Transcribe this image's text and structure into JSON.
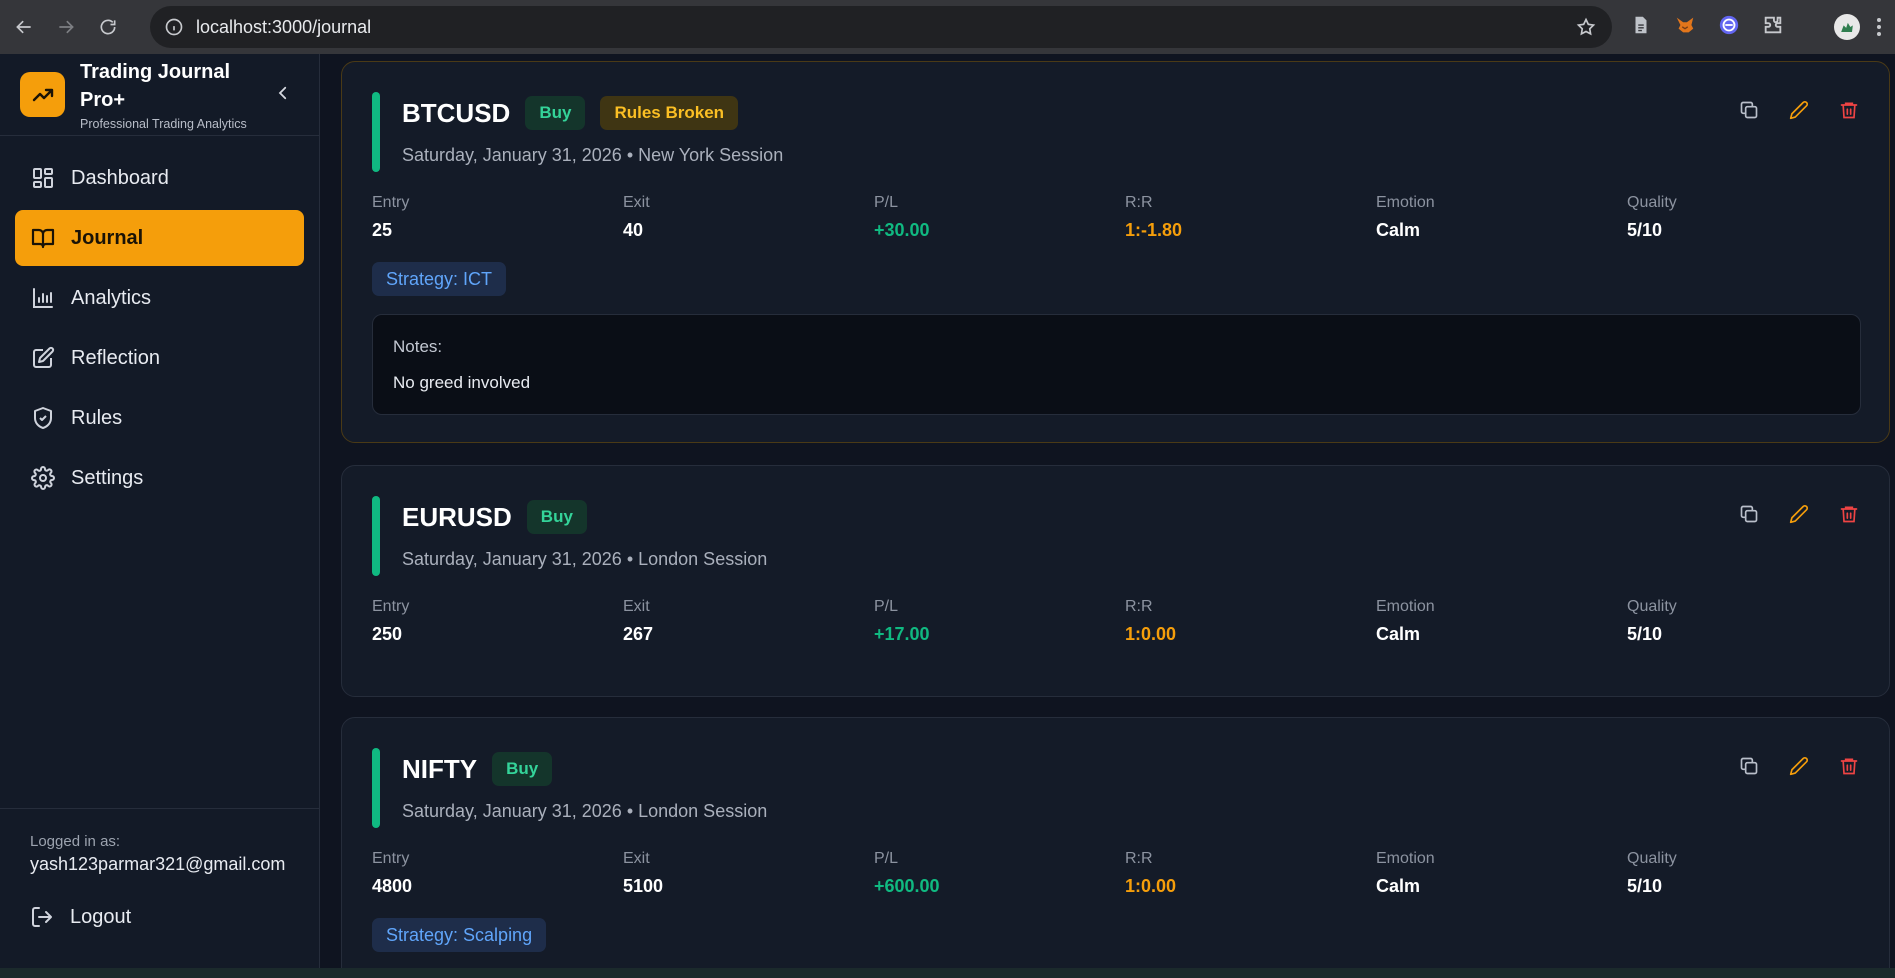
{
  "browser": {
    "url": "localhost:3000/journal"
  },
  "brand": {
    "title": "Trading Journal Pro+",
    "subtitle": "Professional Trading Analytics",
    "accent": "#f59e0b"
  },
  "sidebar": {
    "items": [
      {
        "label": "Dashboard",
        "icon": "dashboard-icon",
        "active": false
      },
      {
        "label": "Journal",
        "icon": "book-icon",
        "active": true
      },
      {
        "label": "Analytics",
        "icon": "bar-chart-icon",
        "active": false
      },
      {
        "label": "Reflection",
        "icon": "edit-square-icon",
        "active": false
      },
      {
        "label": "Rules",
        "icon": "shield-check-icon",
        "active": false
      },
      {
        "label": "Settings",
        "icon": "gear-icon",
        "active": false
      }
    ],
    "logged_label": "Logged in as:",
    "email": "yash123parmar321@gmail.com",
    "logout_label": "Logout"
  },
  "stat_labels": {
    "entry": "Entry",
    "exit": "Exit",
    "pl": "P/L",
    "rr": "R:R",
    "emotion": "Emotion",
    "quality": "Quality"
  },
  "trades": [
    {
      "symbol": "BTCUSD",
      "side": "Buy",
      "rules_badge": "Rules Broken",
      "date_line": "Saturday, January 31, 2026 • New York Session",
      "entry": "25",
      "exit": "40",
      "pl": "+30.00",
      "rr": "1:-1.80",
      "emotion": "Calm",
      "quality": "5/10",
      "strategy": "Strategy: ICT",
      "notes_label": "Notes:",
      "notes": "No greed involved"
    },
    {
      "symbol": "EURUSD",
      "side": "Buy",
      "date_line": "Saturday, January 31, 2026 • London Session",
      "entry": "250",
      "exit": "267",
      "pl": "+17.00",
      "rr": "1:0.00",
      "emotion": "Calm",
      "quality": "5/10"
    },
    {
      "symbol": "NIFTY",
      "side": "Buy",
      "date_line": "Saturday, January 31, 2026 • London Session",
      "entry": "4800",
      "exit": "5100",
      "pl": "+600.00",
      "rr": "1:0.00",
      "emotion": "Calm",
      "quality": "5/10",
      "strategy": "Strategy: Scalping"
    }
  ]
}
